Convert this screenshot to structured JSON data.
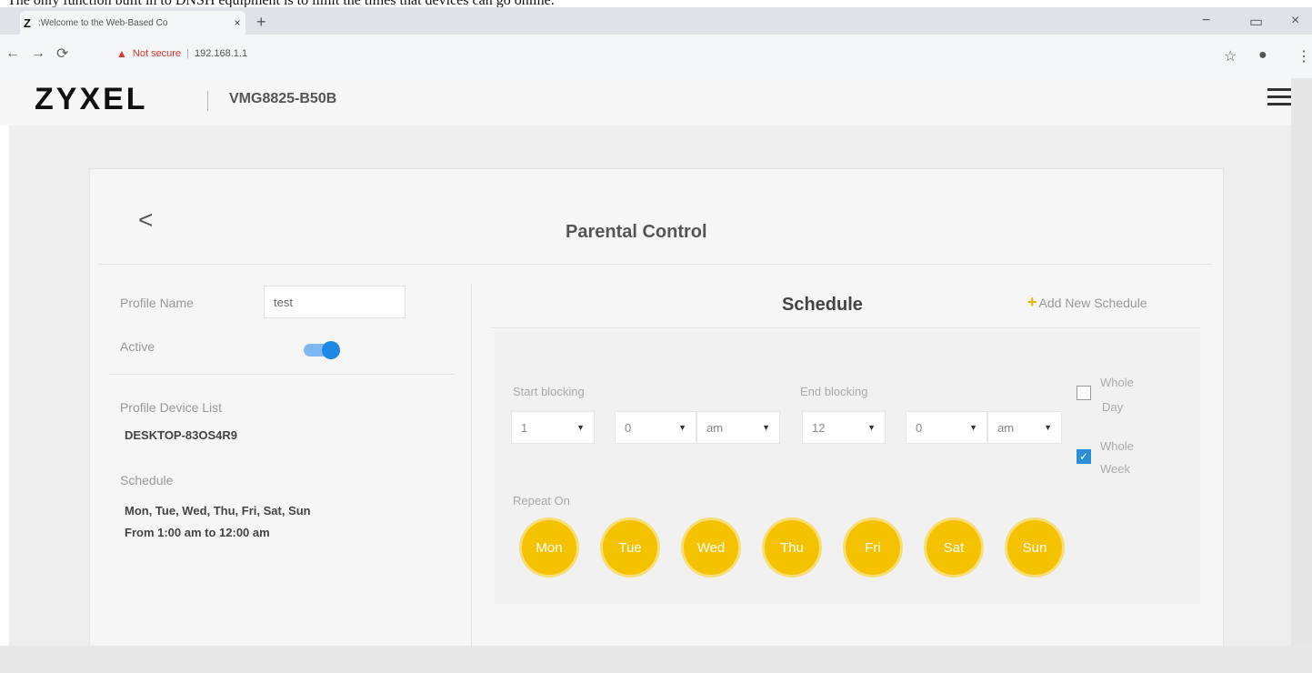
{
  "caption": "The only function built in to DNSH equipment is to limit the times that devices can go online.",
  "browser": {
    "tab_title": ":Welcome to the Web-Based Co",
    "tab_favicon": "Z",
    "tab_close": "×",
    "new_tab": "+",
    "not_secure": "Not secure",
    "url": "192.168.1.1",
    "minimize": "−",
    "maximize": "▭",
    "close": "×"
  },
  "header": {
    "logo": "ZYXEL",
    "model": "VMG8825-B50B"
  },
  "page": {
    "back": "<",
    "title": "Parental Control"
  },
  "profile": {
    "name_label": "Profile Name",
    "name_value": "test",
    "active_label": "Active",
    "active": true,
    "device_list_label": "Profile Device List",
    "device": "DESKTOP-83OS4R9",
    "schedule_label": "Schedule",
    "schedule_days": "Mon, Tue, Wed, Thu, Fri, Sat, Sun",
    "schedule_time": "From 1:00 am to 12:00 am"
  },
  "schedule": {
    "title": "Schedule",
    "add_new": "Add New Schedule",
    "start_label": "Start blocking",
    "end_label": "End blocking",
    "start_hour": "1",
    "start_min": "0",
    "start_ampm": "am",
    "end_hour": "12",
    "end_min": "0",
    "end_ampm": "am",
    "whole_day_1": "Whole",
    "whole_day_2": "Day",
    "whole_day_checked": false,
    "whole_week_1": "Whole",
    "whole_week_2": "Week",
    "whole_week_checked": true,
    "repeat_label": "Repeat On",
    "days": [
      "Mon",
      "Tue",
      "Wed",
      "Thu",
      "Fri",
      "Sat",
      "Sun"
    ]
  },
  "colors": {
    "accent_yellow": "#f5c200",
    "toggle_blue": "#1e88e5",
    "checkbox_blue": "#2b8fd8"
  }
}
